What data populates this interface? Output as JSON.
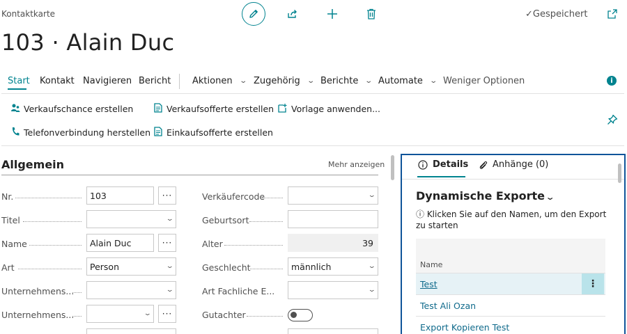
{
  "header": {
    "caption": "Kontaktkarte",
    "saved_label": "Gespeichert",
    "title": "103 · Alain Duc"
  },
  "menu": {
    "items": [
      {
        "label": "Start",
        "active": true,
        "dropdown": false
      },
      {
        "label": "Kontakt",
        "active": false,
        "dropdown": false
      },
      {
        "label": "Navigieren",
        "active": false,
        "dropdown": false
      },
      {
        "label": "Bericht",
        "active": false,
        "dropdown": false
      },
      {
        "label": "Aktionen",
        "active": false,
        "dropdown": true
      },
      {
        "label": "Zugehörig",
        "active": false,
        "dropdown": true
      },
      {
        "label": "Berichte",
        "active": false,
        "dropdown": true
      },
      {
        "label": "Automate",
        "active": false,
        "dropdown": true
      },
      {
        "label": "Weniger Optionen",
        "active": false,
        "dropdown": false
      }
    ]
  },
  "actions": {
    "sales_opportunity": "Verkaufschance erstellen",
    "sales_quote": "Verkaufsofferte erstellen",
    "apply_template": "Vorlage anwenden...",
    "phone_call": "Telefonverbindung herstellen",
    "purchase_quote": "Einkaufsofferte erstellen"
  },
  "general": {
    "title": "Allgemein",
    "more_label": "Mehr anzeigen",
    "left_fields": [
      {
        "label": "Nr.",
        "value": "103",
        "type": "text-ellipsis"
      },
      {
        "label": "Titel",
        "value": "",
        "type": "select"
      },
      {
        "label": "Name",
        "value": "Alain Duc",
        "type": "text-ellipsis"
      },
      {
        "label": "Art",
        "value": "Person",
        "type": "select"
      },
      {
        "label": "Unternehmens...",
        "value": "",
        "type": "select"
      },
      {
        "label": "Unternehmens...",
        "value": "",
        "type": "select-ellipsis"
      }
    ],
    "right_fields": [
      {
        "label": "Verkäufercode",
        "value": "",
        "type": "select"
      },
      {
        "label": "Geburtsort",
        "value": "",
        "type": "text"
      },
      {
        "label": "Alter",
        "value": "39",
        "type": "readonly"
      },
      {
        "label": "Geschlecht",
        "value": "männlich",
        "type": "select"
      },
      {
        "label": "Art Fachliche E...",
        "value": "",
        "type": "select"
      },
      {
        "label": "Gutachter",
        "value": "off",
        "type": "toggle"
      }
    ]
  },
  "factbox": {
    "tab_details": "Details",
    "tab_attachments": "Anhänge (0)",
    "section_title": "Dynamische Exporte",
    "hint": "ⓘ Klicken Sie auf den Namen, um den Export zu starten",
    "column_name": "Name",
    "rows": [
      "Test",
      "Test Ali Ozan",
      "Export Kopieren Test"
    ]
  },
  "colors": {
    "accent": "#00838f",
    "link": "#0f6a8b",
    "focus_border": "#0f5499"
  }
}
